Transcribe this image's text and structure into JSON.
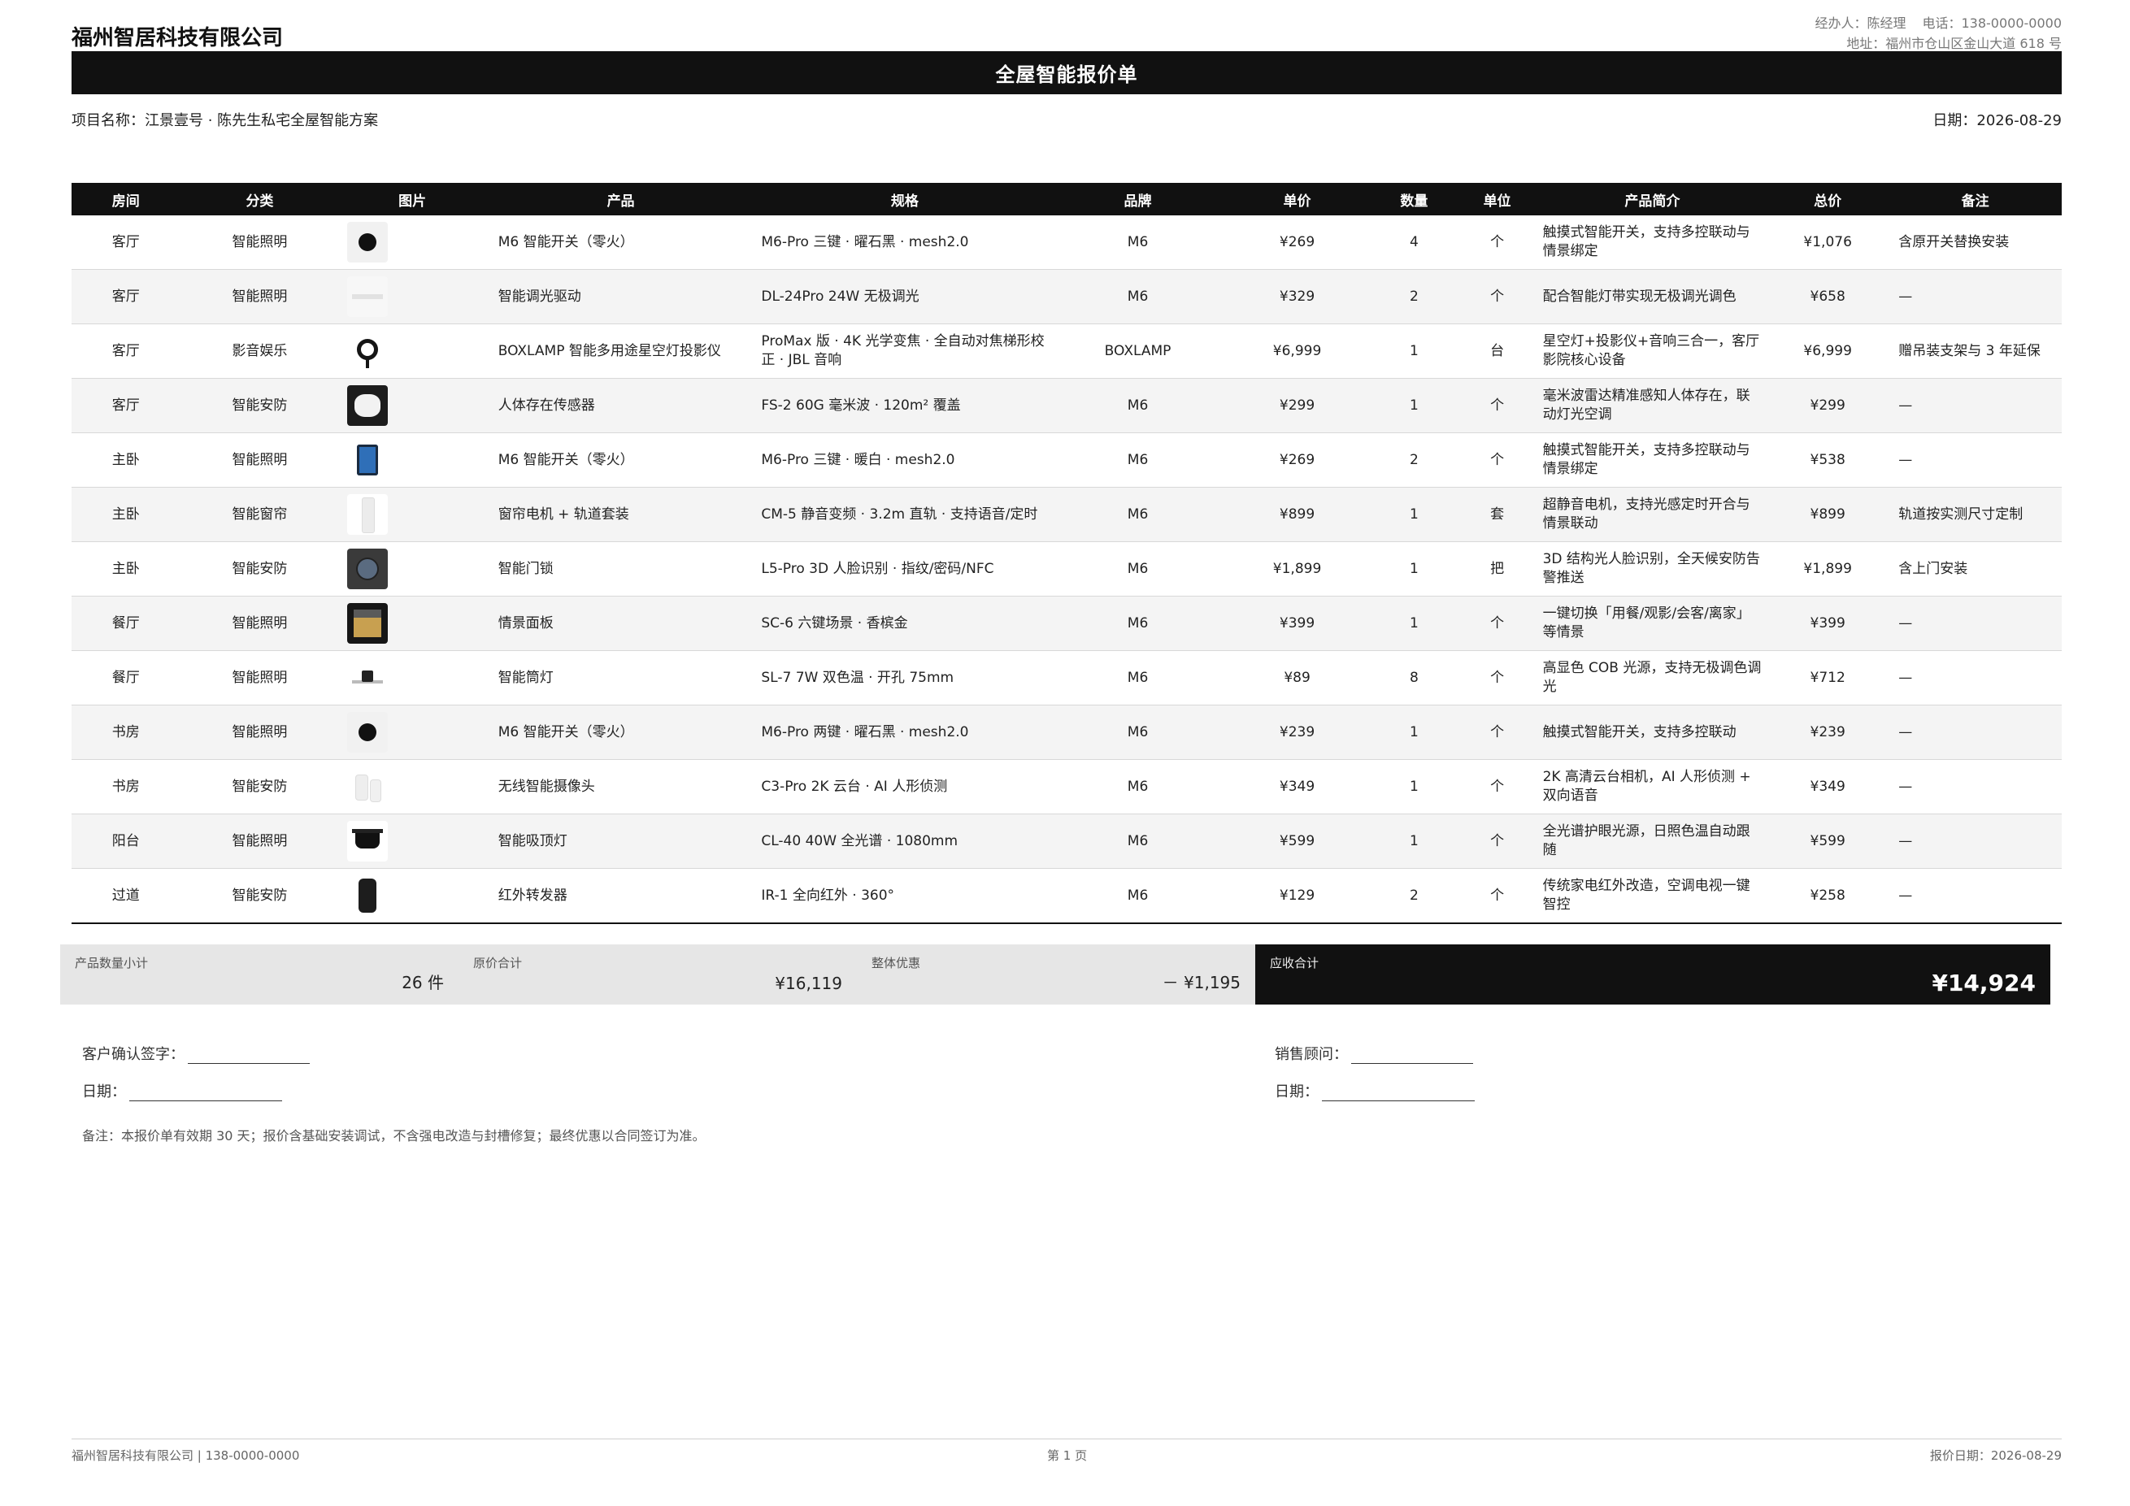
{
  "header": {
    "company": "福州智居科技有限公司",
    "manager": "经办人：陈经理",
    "phone": "电话：138-0000-0000",
    "address": "地址：福州市仓山区金山大道 618 号"
  },
  "title": "全屋智能报价单",
  "meta": {
    "project": "项目名称：江景壹号 · 陈先生私宅全屋智能方案",
    "date": "日期：2026-08-29"
  },
  "table": {
    "headers": [
      "房间",
      "分类",
      "图片",
      "产品",
      "规格",
      "品牌",
      "单价",
      "数量",
      "单位",
      "产品简介",
      "总价",
      "备注"
    ],
    "rows": [
      {
        "room": "客厅",
        "category": "智能照明",
        "image": "smart-switch-image",
        "product": "M6 智能开关（零火）",
        "spec": "M6-Pro 三键 · 曜石黑 · mesh2.0",
        "brand": "M6",
        "unit_price": "¥269",
        "qty": "4",
        "unit": "个",
        "desc": "触摸式智能开关，支持多控联动与情景绑定",
        "total": "¥1,076",
        "remark": "含原开关替换安装"
      },
      {
        "room": "客厅",
        "category": "智能照明",
        "image": "dimmer-driver-image",
        "product": "智能调光驱动",
        "spec": "DL-24Pro 24W 无极调光",
        "brand": "M6",
        "unit_price": "¥329",
        "qty": "2",
        "unit": "个",
        "desc": "配合智能灯带实现无极调光调色",
        "total": "¥658",
        "remark": "—"
      },
      {
        "room": "客厅",
        "category": "影音娱乐",
        "image": "projector-lamp-image",
        "product": "BOXLAMP 智能多用途星空灯投影仪",
        "spec": "ProMax 版 · 4K 光学变焦 · 全自动对焦梯形校正 · JBL 音响",
        "brand": "BOXLAMP",
        "unit_price": "¥6,999",
        "qty": "1",
        "unit": "台",
        "desc": "星空灯+投影仪+音响三合一，客厅影院核心设备",
        "total": "¥6,999",
        "remark": "赠吊装支架与 3 年延保"
      },
      {
        "room": "客厅",
        "category": "智能安防",
        "image": "presence-sensor-image",
        "product": "人体存在传感器",
        "spec": "FS-2 60G 毫米波 · 120m² 覆盖",
        "brand": "M6",
        "unit_price": "¥299",
        "qty": "1",
        "unit": "个",
        "desc": "毫米波雷达精准感知人体存在，联动灯光空调",
        "total": "¥299",
        "remark": "—"
      },
      {
        "room": "主卧",
        "category": "智能照明",
        "image": "smart-switch-white-image",
        "product": "M6 智能开关（零火）",
        "spec": "M6-Pro 三键 · 暖白 · mesh2.0",
        "brand": "M6",
        "unit_price": "¥269",
        "qty": "2",
        "unit": "个",
        "desc": "触摸式智能开关，支持多控联动与情景绑定",
        "total": "¥538",
        "remark": "—"
      },
      {
        "room": "主卧",
        "category": "智能窗帘",
        "image": "curtain-motor-image",
        "product": "窗帘电机 + 轨道套装",
        "spec": "CM-5 静音变频 · 3.2m 直轨 · 支持语音/定时",
        "brand": "M6",
        "unit_price": "¥899",
        "qty": "1",
        "unit": "套",
        "desc": "超静音电机，支持光感定时开合与情景联动",
        "total": "¥899",
        "remark": "轨道按实测尺寸定制"
      },
      {
        "room": "主卧",
        "category": "智能安防",
        "image": "smart-lock-image",
        "product": "智能门锁",
        "spec": "L5-Pro 3D 人脸识别 · 指纹/密码/NFC",
        "brand": "M6",
        "unit_price": "¥1,899",
        "qty": "1",
        "unit": "把",
        "desc": "3D 结构光人脸识别，全天候安防告警推送",
        "total": "¥1,899",
        "remark": "含上门安装"
      },
      {
        "room": "餐厅",
        "category": "智能照明",
        "image": "scene-panel-image",
        "product": "情景面板",
        "spec": "SC-6 六键场景 · 香槟金",
        "brand": "M6",
        "unit_price": "¥399",
        "qty": "1",
        "unit": "个",
        "desc": "一键切换「用餐/观影/会客/离家」等情景",
        "total": "¥399",
        "remark": "—"
      },
      {
        "room": "餐厅",
        "category": "智能照明",
        "image": "downlight-image",
        "product": "智能筒灯",
        "spec": "SL-7 7W 双色温 · 开孔 75mm",
        "brand": "M6",
        "unit_price": "¥89",
        "qty": "8",
        "unit": "个",
        "desc": "高显色 COB 光源，支持无极调色调光",
        "total": "¥712",
        "remark": "—"
      },
      {
        "room": "书房",
        "category": "智能照明",
        "image": "smart-switch-two-key-image",
        "product": "M6 智能开关（零火）",
        "spec": "M6-Pro 两键 · 曜石黑 · mesh2.0",
        "brand": "M6",
        "unit_price": "¥239",
        "qty": "1",
        "unit": "个",
        "desc": "触摸式智能开关，支持多控联动",
        "total": "¥239",
        "remark": "—"
      },
      {
        "room": "书房",
        "category": "智能安防",
        "image": "camera-image",
        "product": "无线智能摄像头",
        "spec": "C3-Pro 2K 云台 · AI 人形侦测",
        "brand": "M6",
        "unit_price": "¥349",
        "qty": "1",
        "unit": "个",
        "desc": "2K 高清云台相机，AI 人形侦测 + 双向语音",
        "total": "¥349",
        "remark": "—"
      },
      {
        "room": "阳台",
        "category": "智能照明",
        "image": "ceiling-light-image",
        "product": "智能吸顶灯",
        "spec": "CL-40 40W 全光谱 · 1080mm",
        "brand": "M6",
        "unit_price": "¥599",
        "qty": "1",
        "unit": "个",
        "desc": "全光谱护眼光源，日照色温自动跟随",
        "total": "¥599",
        "remark": "—"
      },
      {
        "room": "过道",
        "category": "智能安防",
        "image": "ir-repeater-image",
        "product": "红外转发器",
        "spec": "IR-1 全向红外 · 360°",
        "brand": "M6",
        "unit_price": "¥129",
        "qty": "2",
        "unit": "个",
        "desc": "传统家电红外改造，空调电视一键智控",
        "total": "¥258",
        "remark": "—"
      }
    ]
  },
  "summary": {
    "qty_label": "产品数量小计",
    "qty_value": "26 件",
    "original_label": "原价合计",
    "original_value": "¥16,119",
    "discount_label": "整体优惠",
    "discount_value": "－ ¥1,195",
    "total_label": "应收合计",
    "total_value": "¥14,924"
  },
  "signature": {
    "customer_label": "客户确认签字：",
    "customer_date_label": "日期：",
    "sales_label": "销售顾问：",
    "sales_date_label": "日期："
  },
  "note": "备注：本报价单有效期 30 天；报价含基础安装调试，不含强电改造与封槽修复；最终优惠以合同签订为准。",
  "footer": {
    "left": "福州智居科技有限公司 | 138-0000-0000",
    "center": "第 1 页",
    "right": "报价日期：2026-08-29"
  }
}
